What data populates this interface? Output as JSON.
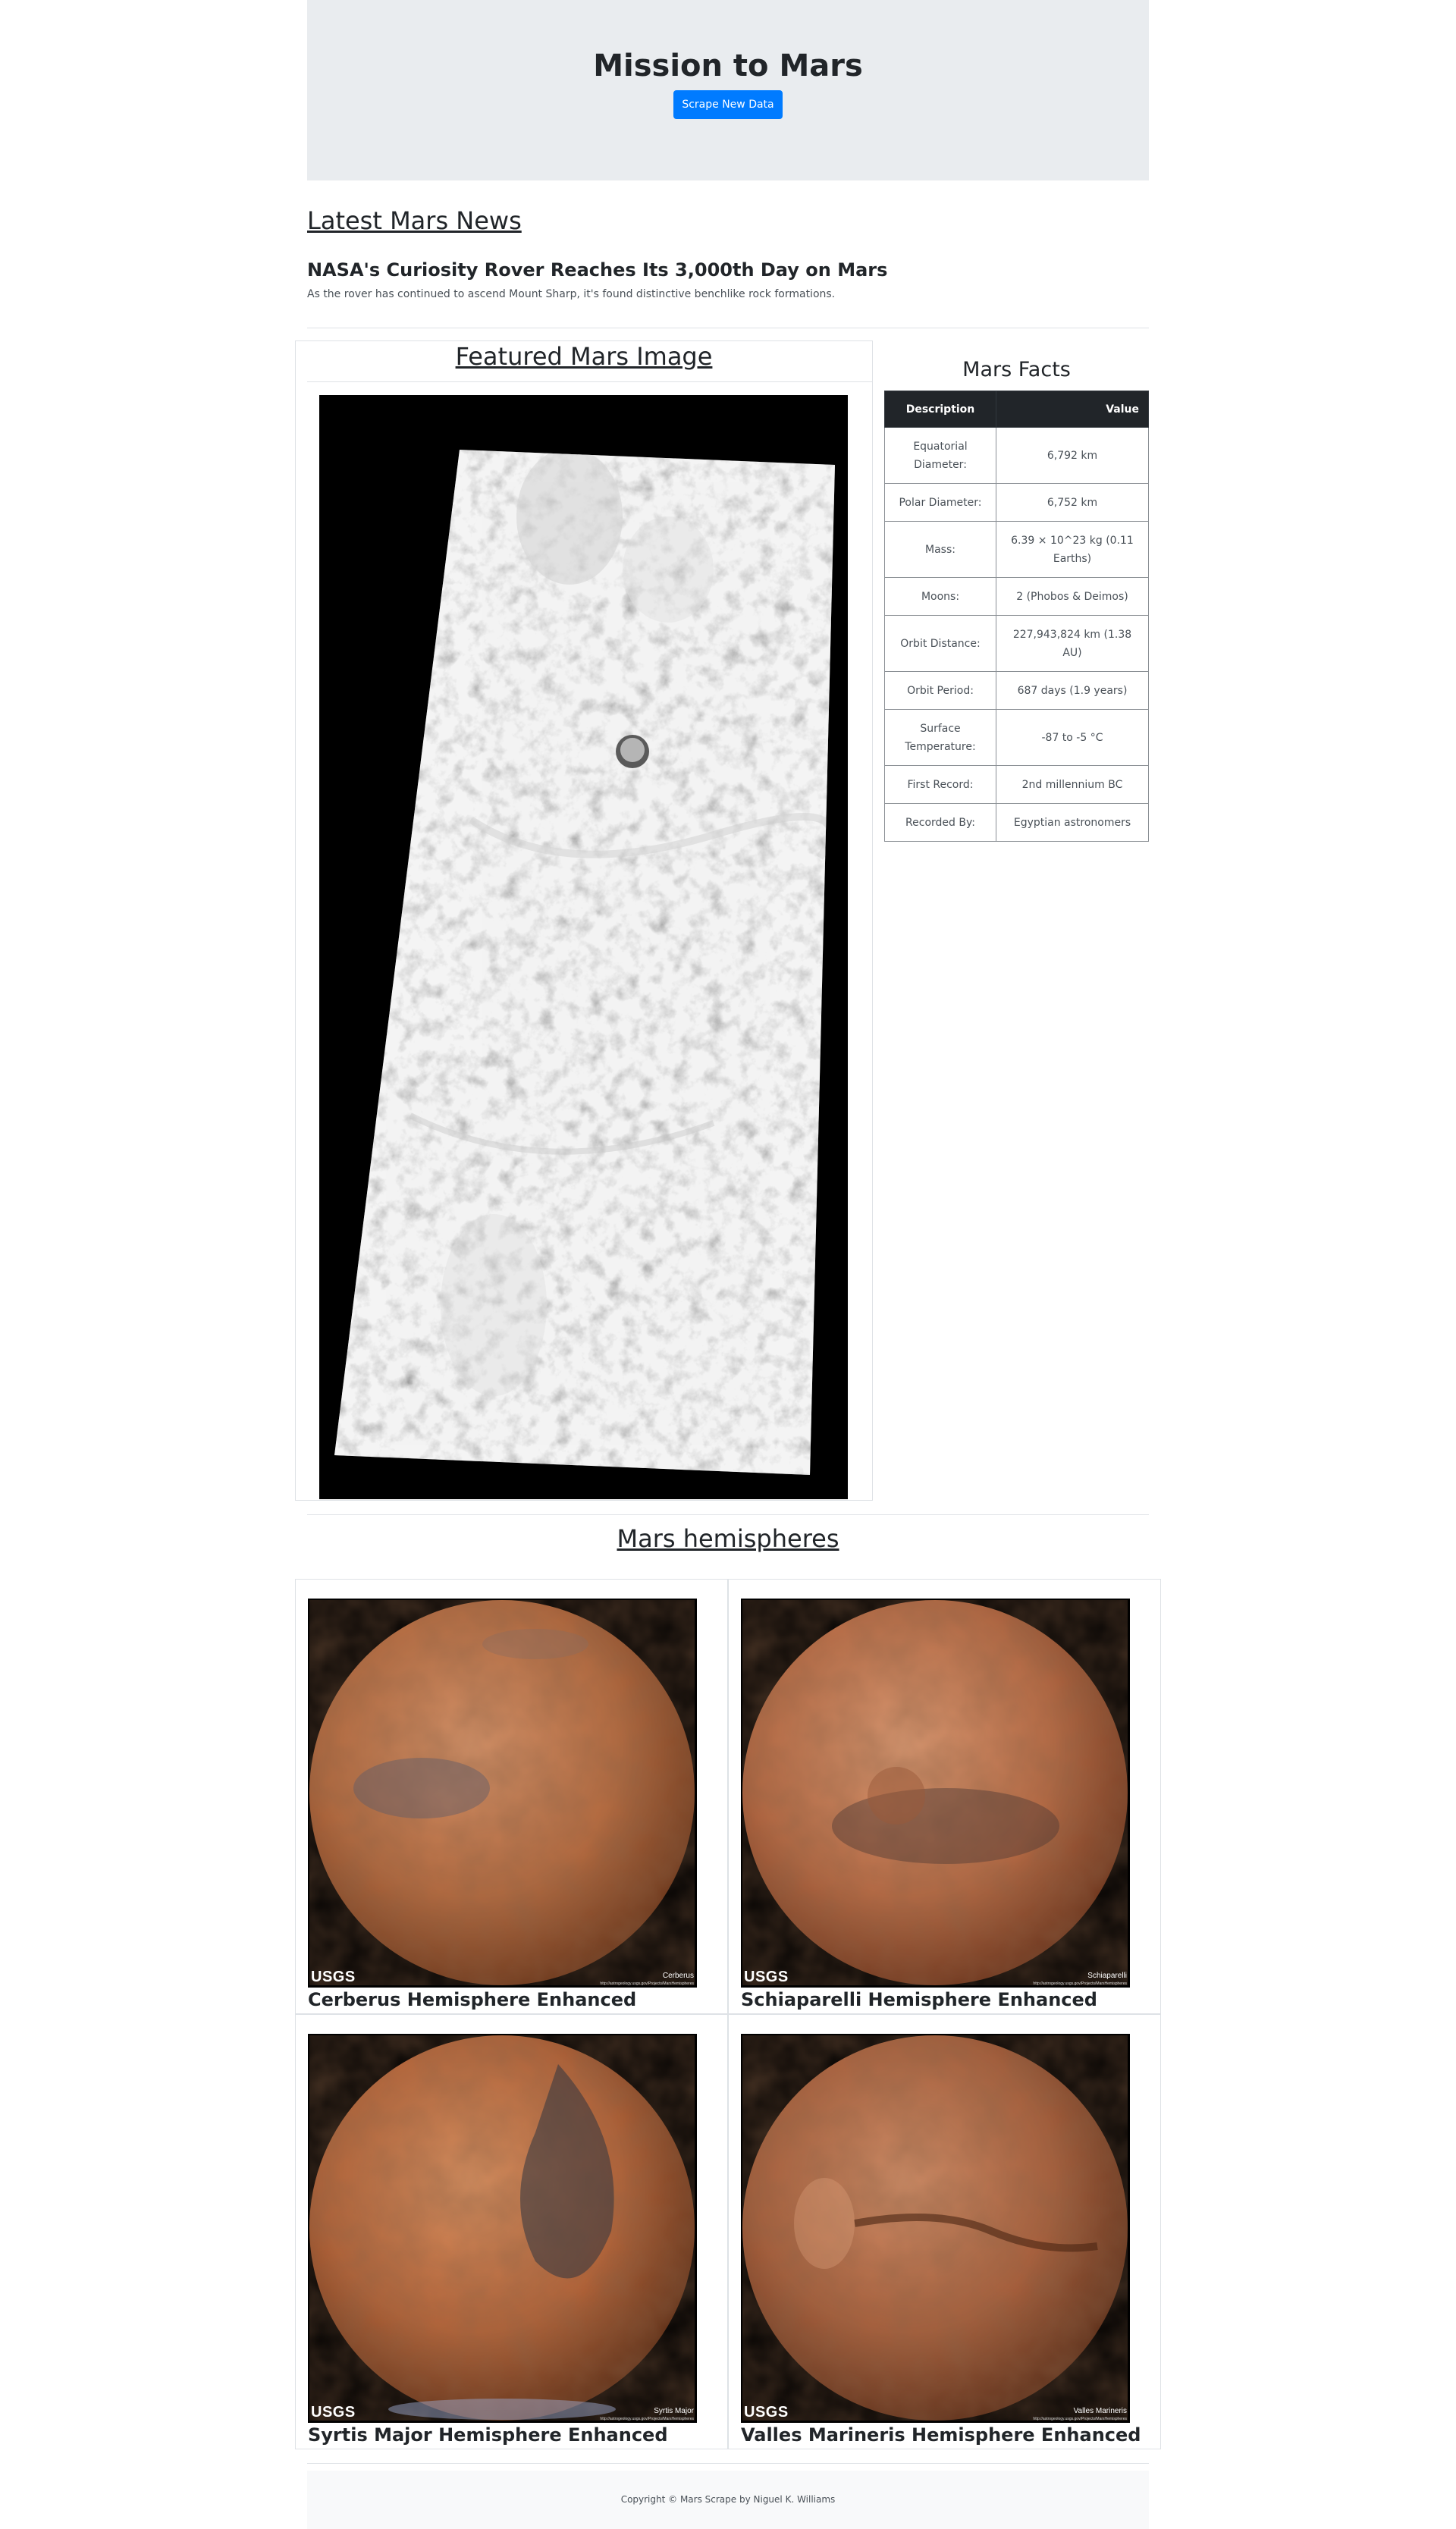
{
  "header": {
    "title": "Mission to Mars",
    "scrape_button_label": "Scrape New Data"
  },
  "news": {
    "section_title": "Latest Mars News",
    "headline": "NASA's Curiosity Rover Reaches Its 3,000th Day on Mars",
    "teaser": "As the rover has continued to ascend Mount Sharp, it's found distinctive benchlike rock formations."
  },
  "featured": {
    "section_title": "Featured Mars Image"
  },
  "facts": {
    "title": "Mars Facts",
    "headers": {
      "description": "Description",
      "value": "Value"
    },
    "rows": [
      {
        "description": "Equatorial Diameter:",
        "value": "6,792 km"
      },
      {
        "description": "Polar Diameter:",
        "value": "6,752 km"
      },
      {
        "description": "Mass:",
        "value": "6.39 × 10^23 kg (0.11 Earths)"
      },
      {
        "description": "Moons:",
        "value": "2 (Phobos & Deimos)"
      },
      {
        "description": "Orbit Distance:",
        "value": "227,943,824 km (1.38 AU)"
      },
      {
        "description": "Orbit Period:",
        "value": "687 days (1.9 years)"
      },
      {
        "description": "Surface Temperature:",
        "value": "-87 to -5 °C"
      },
      {
        "description": "First Record:",
        "value": "2nd millennium BC"
      },
      {
        "description": "Recorded By:",
        "value": "Egyptian astronomers"
      }
    ]
  },
  "hemispheres": {
    "section_title": "Mars hemispheres",
    "items": [
      {
        "title": "Cerberus Hemisphere Enhanced",
        "image_caption": "Cerberus",
        "logo_text": "USGS",
        "url_text": "http://astrogeology.usgs.gov/Projects/MarsHemispheres"
      },
      {
        "title": "Schiaparelli Hemisphere Enhanced",
        "image_caption": "Schiaparelli",
        "logo_text": "USGS",
        "url_text": "http://astrogeology.usgs.gov/Projects/MarsHemispheres"
      },
      {
        "title": "Syrtis Major Hemisphere Enhanced",
        "image_caption": "Syrtis Major",
        "logo_text": "USGS",
        "url_text": "http://astrogeology.usgs.gov/Projects/MarsHemispheres"
      },
      {
        "title": "Valles Marineris Hemisphere Enhanced",
        "image_caption": "Valles Marineris",
        "logo_text": "USGS",
        "url_text": "http://astrogeology.usgs.gov/Projects/MarsHemispheres"
      }
    ]
  },
  "footer": {
    "text": "Copyright © Mars Scrape by Niguel K. Williams"
  },
  "colors": {
    "jumbotron_bg": "#e9ecef",
    "button_primary": "#007bff",
    "table_header_bg": "#212529",
    "footer_bg": "#f8f9fa",
    "mars_orange": "#c0663d"
  }
}
